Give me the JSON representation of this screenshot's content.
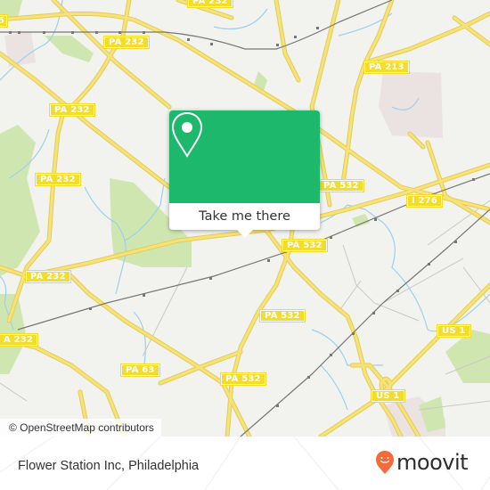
{
  "map": {
    "attribution": "© OpenStreetMap contributors",
    "colors": {
      "background": "#f2f2ee",
      "road": "#f7e27a",
      "road_outline": "#e3cd55",
      "park": "#cfe6b0",
      "water": "#9cd0ee",
      "rail": "#777777",
      "industrial": "#ebe3e1",
      "shield": "#f3dc2a"
    },
    "road_labels": [
      {
        "id": "pa232-top",
        "text": "PA 232"
      },
      {
        "id": "pa232-upper",
        "text": "PA 232"
      },
      {
        "id": "pa232-mid",
        "text": "PA 232"
      },
      {
        "id": "pa232-left",
        "text": "PA 232"
      },
      {
        "id": "pa232-lower",
        "text": "PA 232"
      },
      {
        "id": "pa232-edge",
        "text": "A 232"
      },
      {
        "id": "pa213",
        "text": "PA 213"
      },
      {
        "id": "pa532-a",
        "text": "PA 532"
      },
      {
        "id": "pa532-b",
        "text": "PA 532"
      },
      {
        "id": "pa532-c",
        "text": "PA 532"
      },
      {
        "id": "pa532-d",
        "text": "PA 532"
      },
      {
        "id": "i276",
        "text": "I 276"
      },
      {
        "id": "us1-a",
        "text": "US 1"
      },
      {
        "id": "us1-b",
        "text": "US 1"
      },
      {
        "id": "pa63",
        "text": "PA 63"
      },
      {
        "id": "edge-top-left",
        "text": "5"
      },
      {
        "id": "edge-top",
        "text": "PA 232"
      }
    ]
  },
  "popup": {
    "icon": "map-pin-icon",
    "button_label": "Take me there",
    "color": "#1db86b"
  },
  "footer": {
    "place_name": "Flower Station Inc, Philadelphia",
    "logo_text": "moovit",
    "logo_icon": "moovit-pin-icon",
    "logo_color": "#f26b3a"
  }
}
